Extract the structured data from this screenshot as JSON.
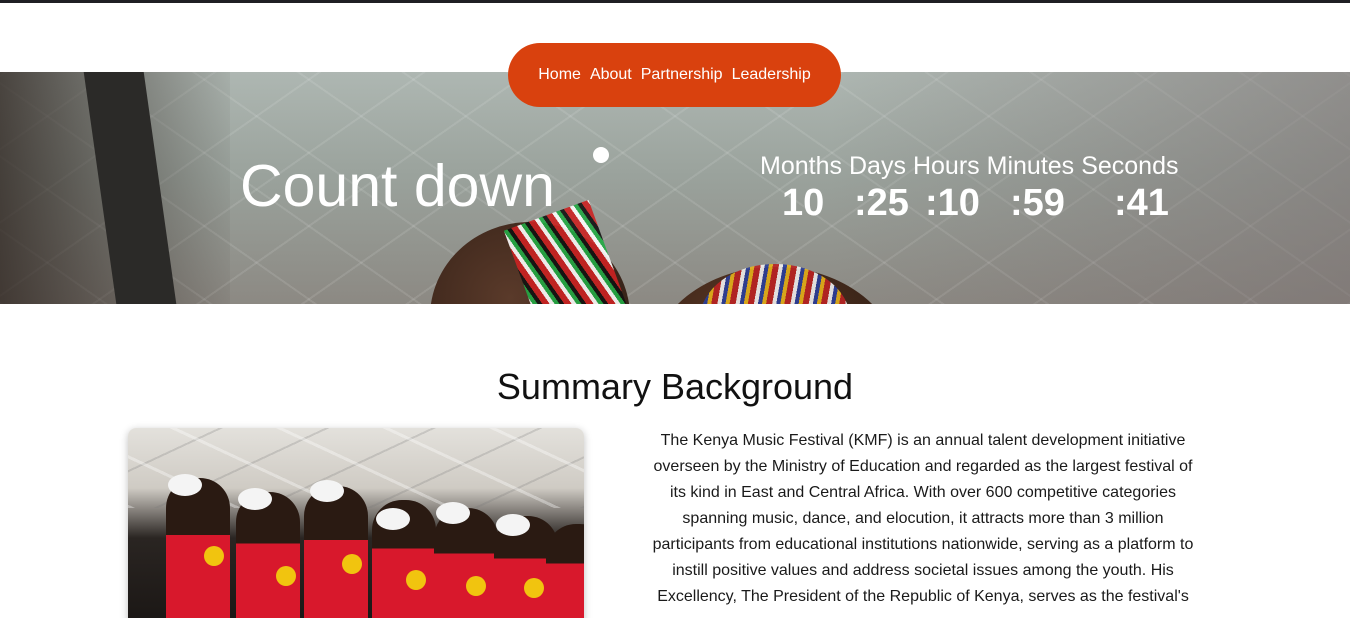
{
  "nav": {
    "items": [
      {
        "label": "Home"
      },
      {
        "label": "About"
      },
      {
        "label": "Partnership"
      },
      {
        "label": "Leadership"
      }
    ]
  },
  "hero": {
    "title": "Count down",
    "timer": {
      "labels": [
        "Months",
        "Days",
        "Hours",
        "Minutes",
        "Seconds"
      ],
      "values": [
        "10",
        ":25",
        ":10",
        ":59",
        ":41"
      ]
    }
  },
  "summary": {
    "title": "Summary Background",
    "lines": [
      "The Kenya Music Festival (KMF) is an annual talent development initiative",
      "overseen by the Ministry of Education and regarded as the largest festival of",
      "its kind in East and Central Africa. With over 600 competitive categories",
      "spanning music, dance, and elocution, it attracts more than 3 million",
      "participants from educational institutions nationwide, serving as a platform to",
      "instill positive values and address societal issues among the youth. His",
      "Excellency, The President of the Republic of Kenya, serves as the festival's"
    ]
  },
  "colors": {
    "nav_background": "#d9410e",
    "hero_text": "#ffffff",
    "body_text": "#111111"
  }
}
